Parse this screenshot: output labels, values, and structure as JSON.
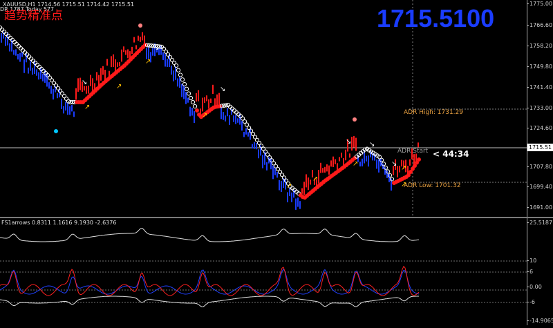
{
  "symbol_line": "XAUUSD,H1  1714.56 1715.51 1714.42 1715.51",
  "adr_line": "DR 1787  Today 577",
  "indicator_title_cn": "趋势精准点",
  "big_price": "1715.5100",
  "levels": {
    "adr_high": "ADR High: 1731.29",
    "adr_start": "ADR Start",
    "adr_low": "ADR Low: 1701.32"
  },
  "countdown": "< 44:34",
  "current_price": "1715.51",
  "price_axis": [
    "1775.00",
    "1766.60",
    "1758.20",
    "1749.80",
    "1741.40",
    "1733.00",
    "1724.60",
    "1715.51",
    "1707.80",
    "1699.40",
    "1691.00"
  ],
  "sub_indicator": "FS1arrows 0.8311 1.1616 9.1930 -2.6376",
  "sub_axis": [
    "25.5187",
    "10",
    "6",
    "0.00",
    "-6",
    "-14.9065"
  ],
  "colors": {
    "bull": "#ff1a1a",
    "bear": "#1a3cff",
    "trend_up": "#ff1a1a",
    "trend_down": "#ffffff",
    "arrow_up": "#ffc000",
    "arrow_down": "#ffffff",
    "adr": "#e8a040",
    "big_price": "#1a3cff"
  },
  "icons": [
    "up-arrow-icon",
    "down-arrow-icon",
    "signal-dot-icon"
  ]
}
